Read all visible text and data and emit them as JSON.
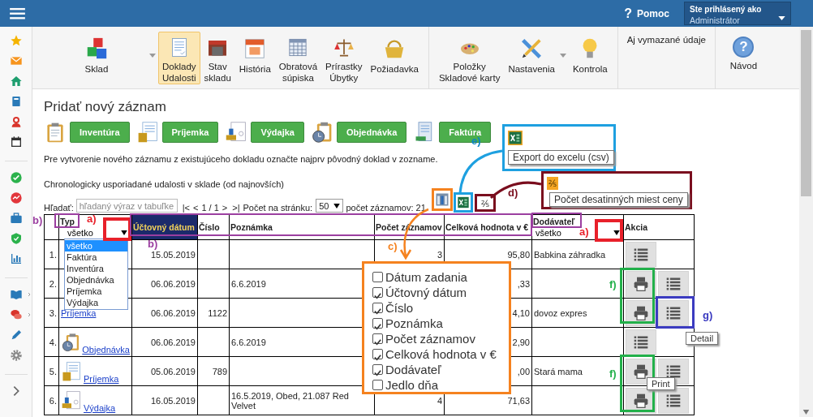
{
  "topbar": {
    "help_icon": "?",
    "help": "Pomoc",
    "user_label": "Ste prihlásený ako",
    "user": "Administrátor"
  },
  "toolbar": {
    "items": [
      {
        "lines": [
          "Sklad"
        ],
        "selected": false,
        "dropdown": true
      },
      {
        "lines": [
          "Doklady",
          "Udalosti"
        ],
        "selected": true,
        "dropdown": false
      },
      {
        "lines": [
          "Stav",
          "skladu"
        ],
        "selected": false,
        "dropdown": false
      },
      {
        "lines": [
          "História"
        ],
        "selected": false,
        "dropdown": false
      },
      {
        "lines": [
          "Obratová",
          "súpiska"
        ],
        "selected": false,
        "dropdown": false
      },
      {
        "lines": [
          "Prírastky",
          "Úbytky"
        ],
        "selected": false,
        "dropdown": false
      },
      {
        "lines": [
          "Požiadavka"
        ],
        "selected": false,
        "dropdown": false
      },
      {
        "lines": [
          "Položky",
          "Skladové karty"
        ],
        "selected": false,
        "dropdown": false
      },
      {
        "lines": [
          "Nastavenia"
        ],
        "selected": false,
        "dropdown": true
      },
      {
        "lines": [
          "Kontrola"
        ],
        "selected": false,
        "dropdown": false
      }
    ],
    "show_deleted": "Aj vymazané údaje",
    "help_icon": "?",
    "help": "Návod"
  },
  "page": {
    "title": "Pridať nový záznam",
    "create_buttons": [
      {
        "label": "Inventúra",
        "kind": "inventory"
      },
      {
        "label": "Príjemka",
        "kind": "receipt"
      },
      {
        "label": "Výdajka",
        "kind": "issue"
      },
      {
        "label": "Objednávka",
        "kind": "order"
      },
      {
        "label": "Faktúra",
        "kind": "invoice"
      }
    ],
    "hint": "Pre vytvorenie nového záznamu z existujúceho dokladu označte najprv pôvodný doklad v zozname.",
    "list_title": "Chronologicky usporiadané udalosti v sklade (od najnovších)"
  },
  "search": {
    "label": "Hľadať:",
    "placeholder": "hľadaný výraz v tabuľke"
  },
  "pager": {
    "first": "|<",
    "prev": "<",
    "page": "1 / 1",
    "next": ">",
    "last": ">|"
  },
  "per_page": {
    "label": "Počet na stránku:",
    "value": "50"
  },
  "count": "počet záznamov: 21",
  "decimals_icon": "⅖",
  "table": {
    "columns": [
      {
        "label": "Typ",
        "filter": "všetko",
        "sorted": false
      },
      {
        "label": "Účtovný dátum",
        "sorted": true
      },
      {
        "label": "Číslo",
        "sorted": false
      },
      {
        "label": "Poznámka",
        "sorted": false
      },
      {
        "label": "Počet záznamov",
        "sorted": false
      },
      {
        "label": "Celková hodnota v €",
        "sorted": false
      },
      {
        "label": "Dodávateľ",
        "filter": "všetko",
        "sorted": false
      },
      {
        "label": "Akcia",
        "sorted": false
      }
    ],
    "rows": [
      {
        "number": "1.",
        "date": "15.05.2019",
        "count": "3",
        "value": "95,80",
        "supplier": "Babkina záhradka",
        "print": false
      },
      {
        "number": "2.",
        "date": "06.06.2019",
        "note": "6.6.2019",
        "value": ",33",
        "print": true
      },
      {
        "number": "3.",
        "type": "Príjemka",
        "date": "06.06.2019",
        "doc_number": "1122",
        "value": "4,10",
        "supplier": "dovoz expres",
        "print": true
      },
      {
        "number": "4.",
        "kind": "order",
        "type": "Objednávka",
        "date": "06.06.2019",
        "note": "6.6.2019",
        "value": "2,90",
        "print": false
      },
      {
        "number": "5.",
        "kind": "receipt",
        "type": "Príjemka",
        "date": "05.06.2019",
        "doc_number": "789",
        "value": ",00",
        "supplier": "Stará mama",
        "print": true
      },
      {
        "number": "6.",
        "kind": "issue",
        "type": "Výdajka",
        "date": "16.05.2019",
        "note": "16.5.2019, Obed, 21.087 Red Velvet",
        "count": "4",
        "value": "71,63",
        "print": true
      }
    ]
  },
  "type_dropdown": {
    "options": [
      {
        "label": "všetko",
        "selected": true
      },
      {
        "label": "Faktúra",
        "selected": false
      },
      {
        "label": "Inventúra",
        "selected": false
      },
      {
        "label": "Objednávka",
        "selected": false
      },
      {
        "label": "Príjemka",
        "selected": false
      },
      {
        "label": "Výdajka",
        "selected": false
      }
    ]
  },
  "column_chooser": {
    "options": [
      {
        "label": "Dátum zadania",
        "checked": false
      },
      {
        "label": "Účtovný dátum",
        "checked": true
      },
      {
        "label": "Číslo",
        "checked": true
      },
      {
        "label": "Poznámka",
        "checked": true
      },
      {
        "label": "Počet záznamov",
        "checked": true
      },
      {
        "label": "Celková hodnota v €",
        "checked": true
      },
      {
        "label": "Dodávateľ",
        "checked": true
      },
      {
        "label": "Jedlo dňa",
        "checked": false
      }
    ]
  },
  "callouts": {
    "excel_tooltip": "Export do excelu (csv)",
    "decimals_icon": "⅖",
    "decimals_tooltip": "Počet desatinných miest ceny"
  },
  "tooltips": {
    "detail": "Detail",
    "print": "Print"
  },
  "annotations": [
    {
      "label": "b)",
      "color": "#9b3fa0"
    },
    {
      "label": "a)",
      "color": "#e8202a"
    },
    {
      "label": "b)",
      "color": "#9b3fa0"
    },
    {
      "label": "c)",
      "color": "#f5821f"
    },
    {
      "label": "a)",
      "color": "#e8202a"
    },
    {
      "label": "e)",
      "color": "#0b84c2"
    },
    {
      "label": "d)",
      "color": "#7a0e1e"
    },
    {
      "label": "f)",
      "color": "#22b04a"
    },
    {
      "label": "f)",
      "color": "#22b04a"
    },
    {
      "label": "g)",
      "color": "#3b3bc0"
    }
  ]
}
